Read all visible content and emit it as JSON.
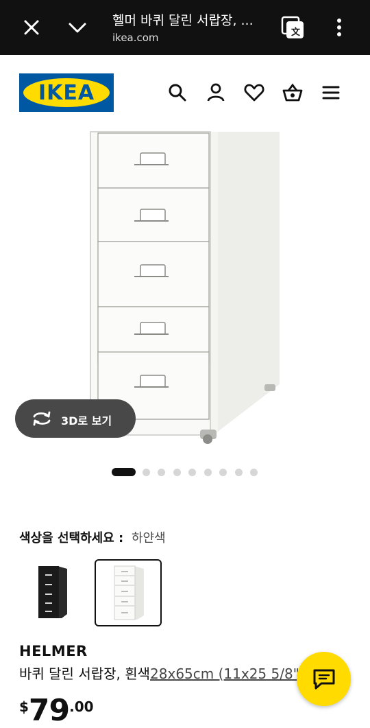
{
  "browser": {
    "title": "헬머 바퀴 달린 서랍장, ...",
    "url": "ikea.com",
    "icons": {
      "close": "close-icon",
      "collapse": "chevron-down-icon",
      "translate": "translate-icon",
      "more": "more-vertical-icon"
    }
  },
  "header": {
    "logo_text": "IKEA",
    "icons": [
      "search-icon",
      "user-icon",
      "heart-icon",
      "basket-icon",
      "menu-icon"
    ]
  },
  "gallery": {
    "view3d_label": "3D로 보기",
    "dot_count": 9,
    "active_index": 0
  },
  "color_select": {
    "label": "색상을 선택하세요 :",
    "value": "하얀색",
    "swatches": [
      "black",
      "white"
    ],
    "selected_index": 1
  },
  "product": {
    "name": "HELMER",
    "description": "바퀴 달린 서랍장, 흰색",
    "size": "28x65cm (11x25 5/8\")",
    "price": {
      "currency": "$",
      "integer": "79",
      "decimal": ".00"
    }
  },
  "colors": {
    "brand_blue": "#0058a3",
    "brand_yellow": "#ffdb00",
    "topbar_bg": "#111111"
  }
}
